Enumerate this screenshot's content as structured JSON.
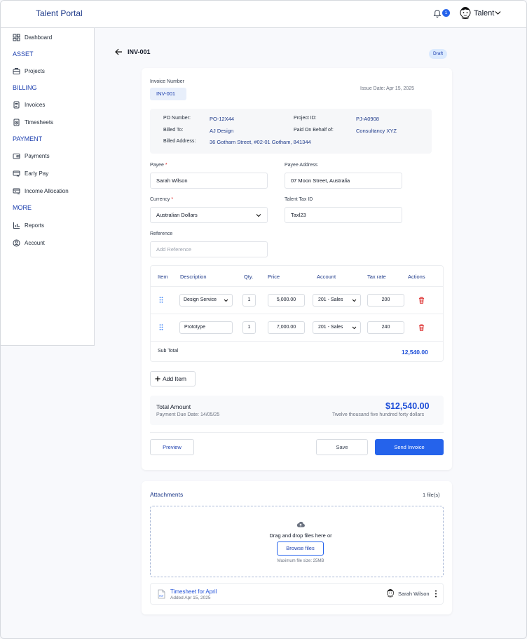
{
  "header": {
    "brand": "Talent Portal",
    "notification_count": "1",
    "user_label": "Talent"
  },
  "sidebar": {
    "items": [
      {
        "label": "Dashboard",
        "icon": "dashboard-icon"
      },
      {
        "label": "Projects",
        "icon": "briefcase-icon"
      },
      {
        "label": "Invoices",
        "icon": "document-icon"
      },
      {
        "label": "Timesheets",
        "icon": "clock-icon"
      },
      {
        "label": "Payments",
        "icon": "wallet-icon"
      },
      {
        "label": "Early Pay",
        "icon": "card-icon"
      },
      {
        "label": "Income Allocation",
        "icon": "allocation-icon"
      },
      {
        "label": "Reports",
        "icon": "chart-icon"
      },
      {
        "label": "Account",
        "icon": "user-circle-icon"
      }
    ],
    "groups": [
      "ASSET",
      "BILLING",
      "PAYMENT",
      "MORE"
    ]
  },
  "page": {
    "title": "INV-001",
    "status": "Draft"
  },
  "invoice": {
    "number_label": "Invoice Number",
    "number": "INV-001",
    "issue_date": "Issue Date: Apr 15, 2025"
  },
  "info": {
    "po_label": "PO Number:",
    "po": "PO-12X44",
    "project_label": "Project ID:",
    "project": "PJ-A0908",
    "billed_to_label": "Billed To:",
    "billed_to": "AJ Design",
    "paid_label": "Paid On Behalf of:",
    "paid": "Consultancy XYZ",
    "address_label": "Billed Address:",
    "address": "36 Gotham Street, #02-01 Gotham, 841344"
  },
  "form": {
    "payee_label": "Payee",
    "payee": "Sarah Wilson",
    "payee_address_label": "Payee Address",
    "payee_address": "07 Moon Street, Australia",
    "currency_label": "Currency",
    "currency": "Australian Dollars",
    "tax_id_label": "Talent Tax ID",
    "tax_id": "Taxl23",
    "reference_label": "Reference",
    "reference_placeholder": "Add Reference",
    "required_mark": "*"
  },
  "items_table": {
    "headers": [
      "Item",
      "Description",
      "Qty.",
      "Price",
      "Account",
      "Tax rate",
      "Actions"
    ],
    "rows": [
      {
        "description": "Design Service",
        "qty": "1",
        "price": "5,000.00",
        "account": "201 - Sales",
        "tax": "200"
      },
      {
        "description": "Prototype",
        "qty": "1",
        "price": "7,000.00",
        "account": "201 - Sales",
        "tax": "240"
      }
    ],
    "subtotal_label": "Sub Total",
    "subtotal": "12,540.00"
  },
  "actions": {
    "add_item": "Add Item",
    "preview": "Preview",
    "save": "Save",
    "send": "Send Invoice"
  },
  "totals": {
    "label": "Total Amount",
    "due": "Payment Due Date: 14/05/25",
    "amount": "$12,540.00",
    "words": "Twelve thousand five hundred forty dollars"
  },
  "attachments": {
    "title": "Attachments",
    "count": "1 file(s)",
    "drop_text": "Drag and drop files here or",
    "browse": "Browse files",
    "max_size": "Maximum file size: 25MB",
    "file": {
      "name": "Timesheet for April",
      "date": "Added Apr 15, 2025",
      "owner": "Sarah Wilson",
      "type_label": "PDF"
    }
  },
  "colors": {
    "accent": "#2563eb",
    "navy": "#1e3a8a",
    "danger": "#dc2626"
  }
}
